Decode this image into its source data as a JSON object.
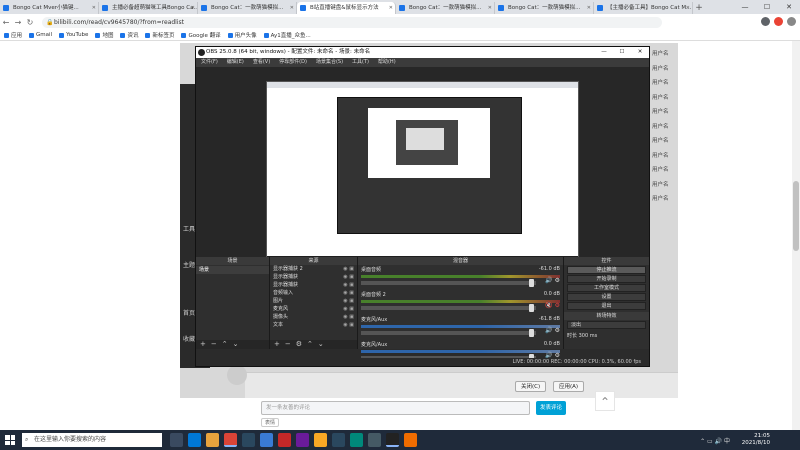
{
  "browser": {
    "tabs": [
      {
        "label": "Bongo Cat Mver小猫键...",
        "active": false
      },
      {
        "label": "主播必备超萌猫咪工具Bongo Ca...",
        "active": false
      },
      {
        "label": "Bongo Cat：一款萌猫模拟...",
        "active": false
      },
      {
        "label": "B站直播键盘&鼠标显示方法",
        "active": true
      },
      {
        "label": "Bongo Cat：一款萌猫模拟...",
        "active": false
      },
      {
        "label": "Bongo Cat：一款萌猫模拟...",
        "active": false
      },
      {
        "label": "【主播必备工具】Bongo Cat M...",
        "active": false
      }
    ],
    "url": "bilibili.com/read/cv9645780/?from=readlist",
    "bookmarks": [
      "应用",
      "Gmail",
      "YouTube",
      "地图",
      "资讯",
      "新标签页",
      "Google 翻译",
      "用户头像",
      "Ay1直播_众鱼..."
    ]
  },
  "page": {
    "names": [
      "用户名",
      "用户名",
      "用户名",
      "用户名",
      "用户名",
      "用户名",
      "用户名",
      "用户名",
      "用户名",
      "用户名",
      "用户名"
    ],
    "left_labels": [
      "工具",
      "主题",
      "首页",
      "收藏"
    ],
    "comment_placeholder": "发一条友善的评论",
    "send_label": "发表评论",
    "emoji_label": "表情",
    "modal_cancel": "关闭(C)",
    "modal_apply": "应用(A)"
  },
  "obs": {
    "title": "OBS 25.0.8 (64 bit, windows) - 配置文件: 未命名 - 场景: 未命名",
    "menu": [
      "文件(F)",
      "编辑(E)",
      "查看(V)",
      "停靠部件(D)",
      "场景集合(S)",
      "工具(T)",
      "帮助(H)"
    ],
    "docks": {
      "scenes": {
        "title": "场景",
        "items": [
          "场景"
        ]
      },
      "sources": {
        "title": "来源",
        "items": [
          "显示器捕获 2",
          "显示器捕获",
          "显示器捕获",
          "音频输入",
          "图片",
          "麦克风",
          "摄像头",
          "文本"
        ]
      },
      "mixer": {
        "title": "混音器",
        "channels": [
          {
            "name": "桌面音频",
            "db": "-61.0 dB",
            "muted": false
          },
          {
            "name": "桌面音频 2",
            "db": "0.0 dB",
            "muted": true
          },
          {
            "name": "麦克风/Aux",
            "db": "-61.8 dB",
            "muted": false
          },
          {
            "name": "麦克风/Aux",
            "db": "0.0 dB",
            "muted": false
          }
        ]
      },
      "transitions": {
        "title": "转场特效",
        "type": "淡出",
        "duration_label": "时长",
        "duration": "300 ms"
      },
      "controls": {
        "title": "控件",
        "buttons": [
          "停止推流",
          "开始录制",
          "工作室模式",
          "设置",
          "退出"
        ]
      }
    },
    "status": "LIVE: 00:00:00   REC: 00:00:00   CPU: 0.3%, 60.00 fps"
  },
  "taskbar": {
    "search_placeholder": "在这里输入你要搜索的内容",
    "time": "21:05",
    "date": "2021/8/10"
  },
  "colors": {
    "accent": "#00a1d6",
    "chrome_blue": "#1a73e8",
    "taskbar": "#1f2a3a"
  }
}
